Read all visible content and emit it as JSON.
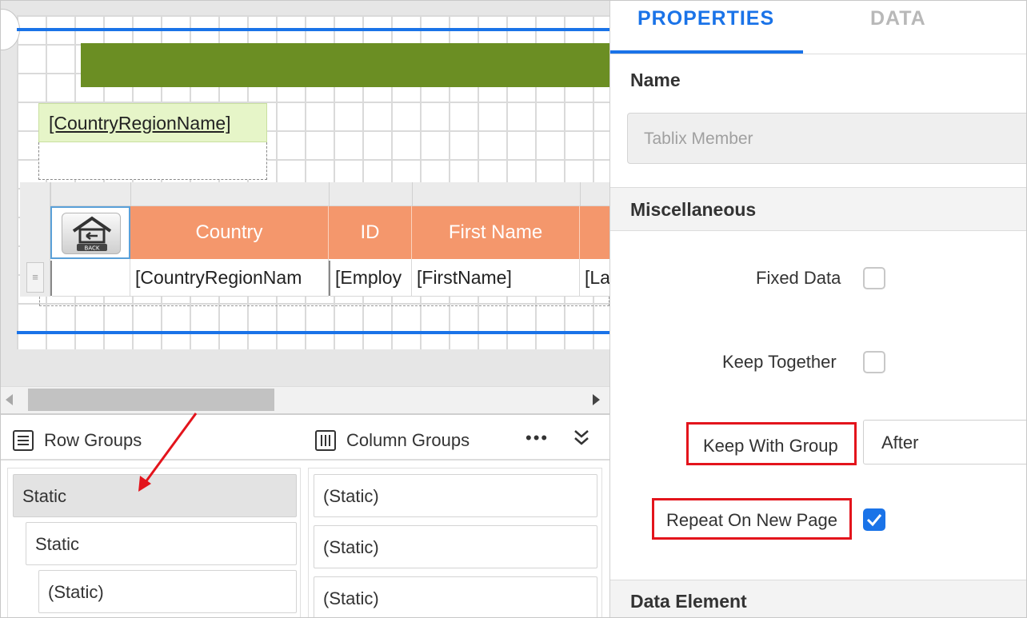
{
  "designer": {
    "country_textbox": "[CountryRegionName]",
    "tablix": {
      "headers": [
        "Country",
        "ID",
        "First Name"
      ],
      "cells": [
        "[CountryRegionNam",
        "[Employ",
        "[FirstName]",
        "[La"
      ],
      "image_button": "BACK"
    }
  },
  "groups": {
    "row_groups_title": "Row Groups",
    "column_groups_title": "Column Groups",
    "more_label": "•••",
    "row_items": [
      "Static",
      "Static",
      "(Static)"
    ],
    "column_items": [
      "(Static)",
      "(Static)",
      "(Static)"
    ]
  },
  "properties": {
    "tabs": [
      "PROPERTIES",
      "DATA"
    ],
    "name_section": "Name",
    "name_placeholder": "Tablix Member",
    "misc_section": "Miscellaneous",
    "fixed_data_label": "Fixed Data",
    "fixed_data_checked": false,
    "keep_together_label": "Keep Together",
    "keep_together_checked": false,
    "keep_with_group_label": "Keep With Group",
    "keep_with_group_value": "After",
    "repeat_on_new_page_label": "Repeat On New Page",
    "repeat_on_new_page_checked": true,
    "data_element_section": "Data Element"
  },
  "colors": {
    "accent": "#1a73e8",
    "header_bar": "#6b8e23",
    "table_header": "#f4976c",
    "textbox_fill": "#e6f5c8",
    "highlight_red": "#e3141c"
  }
}
